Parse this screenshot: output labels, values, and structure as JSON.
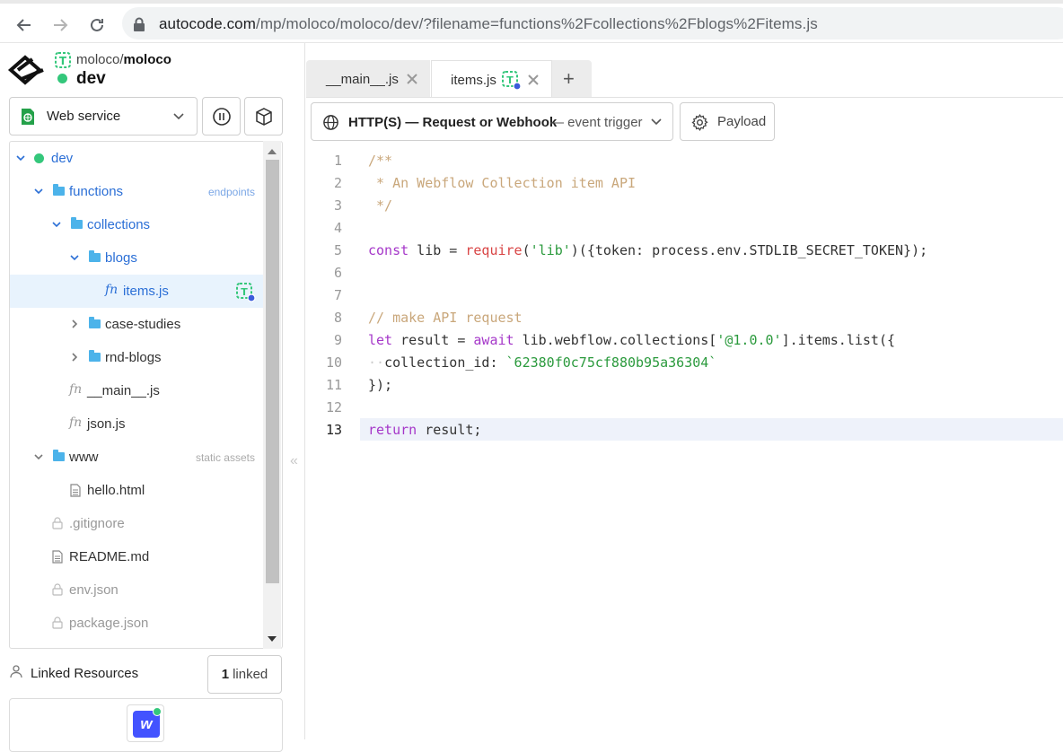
{
  "browser": {
    "url_host": "autocode.com",
    "url_path": "/mp/moloco/moloco/dev/?filename=functions%2Fcollections%2Fblogs%2Fitems.js"
  },
  "project": {
    "owner": "moloco/",
    "name": "moloco",
    "environment": "dev"
  },
  "service_select": {
    "label": "Web service"
  },
  "file_tree": [
    {
      "label": "dev",
      "tag": ""
    },
    {
      "label": "functions",
      "tag": "endpoints"
    },
    {
      "label": "collections",
      "tag": ""
    },
    {
      "label": "blogs",
      "tag": ""
    },
    {
      "label": "items.js",
      "tag": ""
    },
    {
      "label": "case-studies",
      "tag": ""
    },
    {
      "label": "rnd-blogs",
      "tag": ""
    },
    {
      "label": "__main__.js",
      "tag": ""
    },
    {
      "label": "json.js",
      "tag": ""
    },
    {
      "label": "www",
      "tag": "static assets"
    },
    {
      "label": "hello.html",
      "tag": ""
    },
    {
      "label": ".gitignore",
      "tag": ""
    },
    {
      "label": "README.md",
      "tag": ""
    },
    {
      "label": "env.json",
      "tag": ""
    },
    {
      "label": "package.json",
      "tag": ""
    }
  ],
  "linked_resources": {
    "label": "Linked Resources",
    "count": "1",
    "count_suffix": "linked",
    "app_letter": "w"
  },
  "tabs": [
    {
      "label": "__main__.js"
    },
    {
      "label": "items.js"
    }
  ],
  "add_tab_symbol": "+",
  "trigger": {
    "label": "HTTP(S) — Request or Webhook",
    "sub": "— event trigger"
  },
  "payload_label": "Payload",
  "code": {
    "line_numbers": [
      "1",
      "2",
      "3",
      "4",
      "5",
      "6",
      "7",
      "8",
      "9",
      "10",
      "11",
      "12",
      "13"
    ],
    "lines": [
      "/**",
      " * An Webflow Collection item API",
      " */",
      "",
      "const lib = require('lib')({token: process.env.STDLIB_SECRET_TOKEN});",
      "",
      "",
      "// make API request",
      "let result = await lib.webflow.collections['@1.0.0'].items.list({",
      "  collection_id: `62380f0c75cf880b95a36304`",
      "});",
      "",
      "return result;"
    ],
    "current_line": "13"
  },
  "colors": {
    "accent": "#2b6fd6",
    "status_green": "#34c77b",
    "webflow": "#4353ff"
  }
}
